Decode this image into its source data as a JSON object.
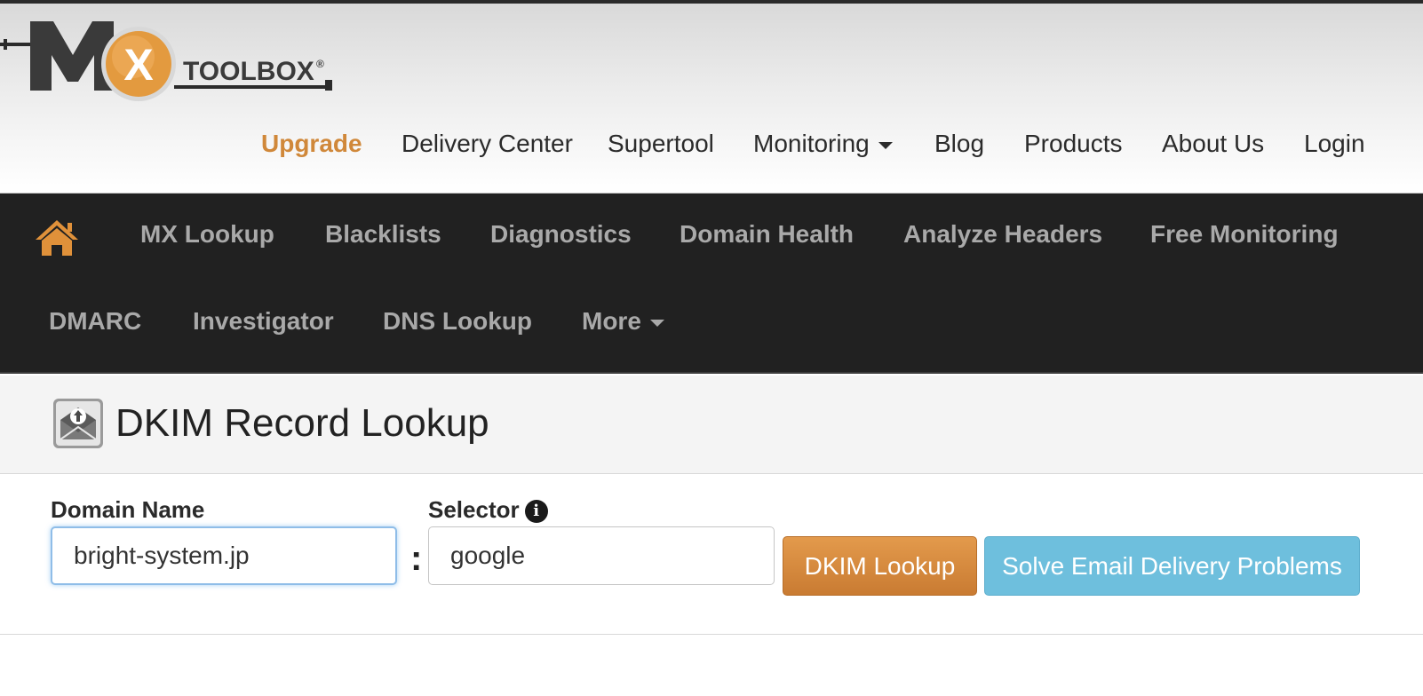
{
  "logo": {
    "text": "TOOLBOX",
    "letters": "MX",
    "registered": "®"
  },
  "top_nav": {
    "upgrade": "Upgrade",
    "delivery_center": "Delivery Center",
    "supertool": "Supertool",
    "monitoring": "Monitoring",
    "blog": "Blog",
    "products": "Products",
    "about_us": "About Us",
    "login": "Login"
  },
  "main_nav": {
    "mx_lookup": "MX Lookup",
    "blacklists": "Blacklists",
    "diagnostics": "Diagnostics",
    "domain_health": "Domain Health",
    "analyze_headers": "Analyze Headers",
    "free_monitoring": "Free Monitoring",
    "dmarc": "DMARC",
    "investigator": "Investigator",
    "dns_lookup": "DNS Lookup",
    "more": "More"
  },
  "page": {
    "title": "DKIM Record Lookup"
  },
  "form": {
    "domain_label": "Domain Name",
    "domain_value": "bright-system.jp",
    "separator": ":",
    "selector_label": "Selector",
    "selector_value": "google",
    "lookup_button": "DKIM Lookup",
    "solve_button": "Solve Email Delivery Problems"
  },
  "colors": {
    "accent_orange": "#d0883a",
    "nav_background": "#212121",
    "nav_text": "#a9a9a9",
    "button_blue": "#6ebfdd"
  }
}
